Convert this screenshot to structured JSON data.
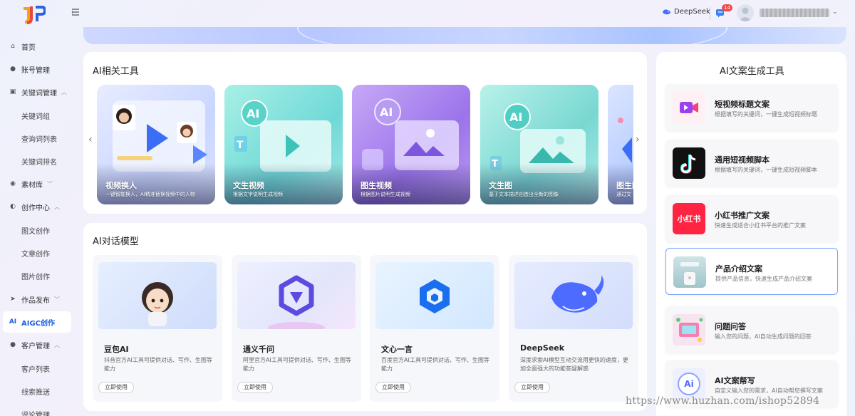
{
  "header": {
    "deepseek_label": "DeepSeek",
    "message_count": "14",
    "collapse_icon": "menu-fold-icon"
  },
  "sidebar": {
    "items": [
      {
        "label": "首页",
        "icon": "home-icon"
      },
      {
        "label": "账号管理",
        "icon": "users-icon"
      },
      {
        "label": "关键词管理",
        "icon": "keyword-icon"
      },
      {
        "label": "关键词组"
      },
      {
        "label": "查询词列表"
      },
      {
        "label": "关键词排名"
      },
      {
        "label": "素材库",
        "icon": "library-icon"
      },
      {
        "label": "创作中心",
        "icon": "create-icon"
      },
      {
        "label": "图文创作"
      },
      {
        "label": "文章创作"
      },
      {
        "label": "图片创作"
      },
      {
        "label": "作品发布",
        "icon": "publish-icon"
      },
      {
        "label": "AIGC创作",
        "icon": "ai-icon",
        "icon_text": "AI"
      },
      {
        "label": "客户管理",
        "icon": "customer-icon"
      },
      {
        "label": "客户列表"
      },
      {
        "label": "线索推送"
      },
      {
        "label": "评论管理"
      }
    ]
  },
  "tools": {
    "title": "AI相关工具",
    "cards": [
      {
        "name": "视频换人",
        "desc": "一键智能换人，AI精准替换视频中的人物"
      },
      {
        "name": "文生视频",
        "desc": "根据文字说明生成视频",
        "badge": "AI"
      },
      {
        "name": "图生视频",
        "desc": "根据图片说明生成视频",
        "badge": "AI"
      },
      {
        "name": "文生图",
        "desc": "基于文本描述创造出全新的图像",
        "badge": "AI"
      },
      {
        "name": "图生图",
        "desc": "通过文"
      }
    ]
  },
  "models": {
    "title": "AI对话模型",
    "cards": [
      {
        "name": "豆包AI",
        "desc": "抖音官方AI工具可提供对话、写作、生图等能力",
        "button": "立即使用"
      },
      {
        "name": "通义千问",
        "desc": "阿里官方AI工具可提供对话、写作、生图等能力",
        "button": "立即使用"
      },
      {
        "name": "文心一言",
        "desc": "百度官方AI工具可提供对话、写作、生图等能力",
        "button": "立即使用"
      },
      {
        "name": "DeepSeek",
        "desc": "深度求索AI模型互动交流用更快的速度，更加全面强大的功能答疑解惑",
        "button": "立即使用"
      }
    ]
  },
  "copy_tools": {
    "title": "AI文案生成工具",
    "cards": [
      {
        "title": "短视频标题文案",
        "desc": "根据填写的关键词，一键生成短视频标题"
      },
      {
        "title": "通用短视频脚本",
        "desc": "根据填写的关键词，一键生成短视频脚本"
      },
      {
        "title": "小红书推广文案",
        "desc": "快速生成适合小红书平台的推广文案",
        "icon_text": "小红书"
      },
      {
        "title": "产品介绍文案",
        "desc": "提供产品信息，快速生成产品介绍文案"
      },
      {
        "title": "问题问答",
        "desc": "输入您的问题，AI自动生成问题的回答"
      },
      {
        "title": "AI文案帮写",
        "desc": "自定义输入您的需求，AI自动帮您撰写文案",
        "icon_text": "Ai"
      }
    ]
  },
  "watermark": "https://www.huzhan.com/ishop52894"
}
